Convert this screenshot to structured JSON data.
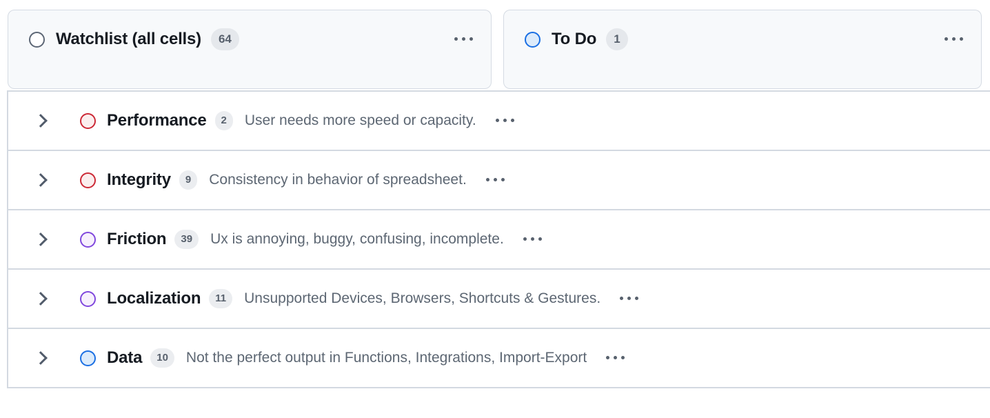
{
  "columns": [
    {
      "id": "watchlist",
      "title": "Watchlist (all cells)",
      "count": "64",
      "status_icon": "circle-outline-icon",
      "circle_border": "#5c6675",
      "circle_fill": "#ffffff",
      "menu_icon": "ellipsis-icon"
    },
    {
      "id": "todo",
      "title": "To Do",
      "count": "1",
      "status_icon": "circle-outline-icon",
      "circle_border": "#1a6fe3",
      "circle_fill": "#dcebfb",
      "menu_icon": "ellipsis-icon"
    }
  ],
  "rows": [
    {
      "id": "performance",
      "expander_icon": "chevron-right-icon",
      "status_icon": "circle-outline-icon",
      "circle_border": "#cc2936",
      "circle_fill": "#fbeeee",
      "title": "Performance",
      "count": "2",
      "description": "User needs more speed or capacity.",
      "menu_icon": "ellipsis-icon"
    },
    {
      "id": "integrity",
      "expander_icon": "chevron-right-icon",
      "status_icon": "circle-outline-icon",
      "circle_border": "#cc2936",
      "circle_fill": "#fbeeee",
      "title": "Integrity",
      "count": "9",
      "description": "Consistency in behavior of spreadsheet.",
      "menu_icon": "ellipsis-icon"
    },
    {
      "id": "friction",
      "expander_icon": "chevron-right-icon",
      "status_icon": "circle-outline-icon",
      "circle_border": "#8048dd",
      "circle_fill": "#f7f0fd",
      "title": "Friction",
      "count": "39",
      "description": "Ux is annoying, buggy, confusing, incomplete.",
      "menu_icon": "ellipsis-icon"
    },
    {
      "id": "localization",
      "expander_icon": "chevron-right-icon",
      "status_icon": "circle-outline-icon",
      "circle_border": "#8048dd",
      "circle_fill": "#f7f0fd",
      "title": "Localization",
      "count": "11",
      "description": "Unsupported Devices, Browsers, Shortcuts & Gestures.",
      "menu_icon": "ellipsis-icon"
    },
    {
      "id": "data",
      "expander_icon": "chevron-right-icon",
      "status_icon": "circle-outline-icon",
      "circle_border": "#1a6fe3",
      "circle_fill": "#dcebfb",
      "title": "Data",
      "count": "10",
      "description": "Not the perfect output in Functions, Integrations, Import-Export",
      "menu_icon": "ellipsis-icon"
    }
  ],
  "theme": {
    "page_bg": "#ffffff",
    "card_bg": "#f7f9fb",
    "card_border": "#d5dbe3",
    "row_border": "#d3d9e1",
    "title_color": "#161b22",
    "desc_color": "#5d6773",
    "badge_bg": "#e5e8ec",
    "badge_text": "#58616d"
  }
}
